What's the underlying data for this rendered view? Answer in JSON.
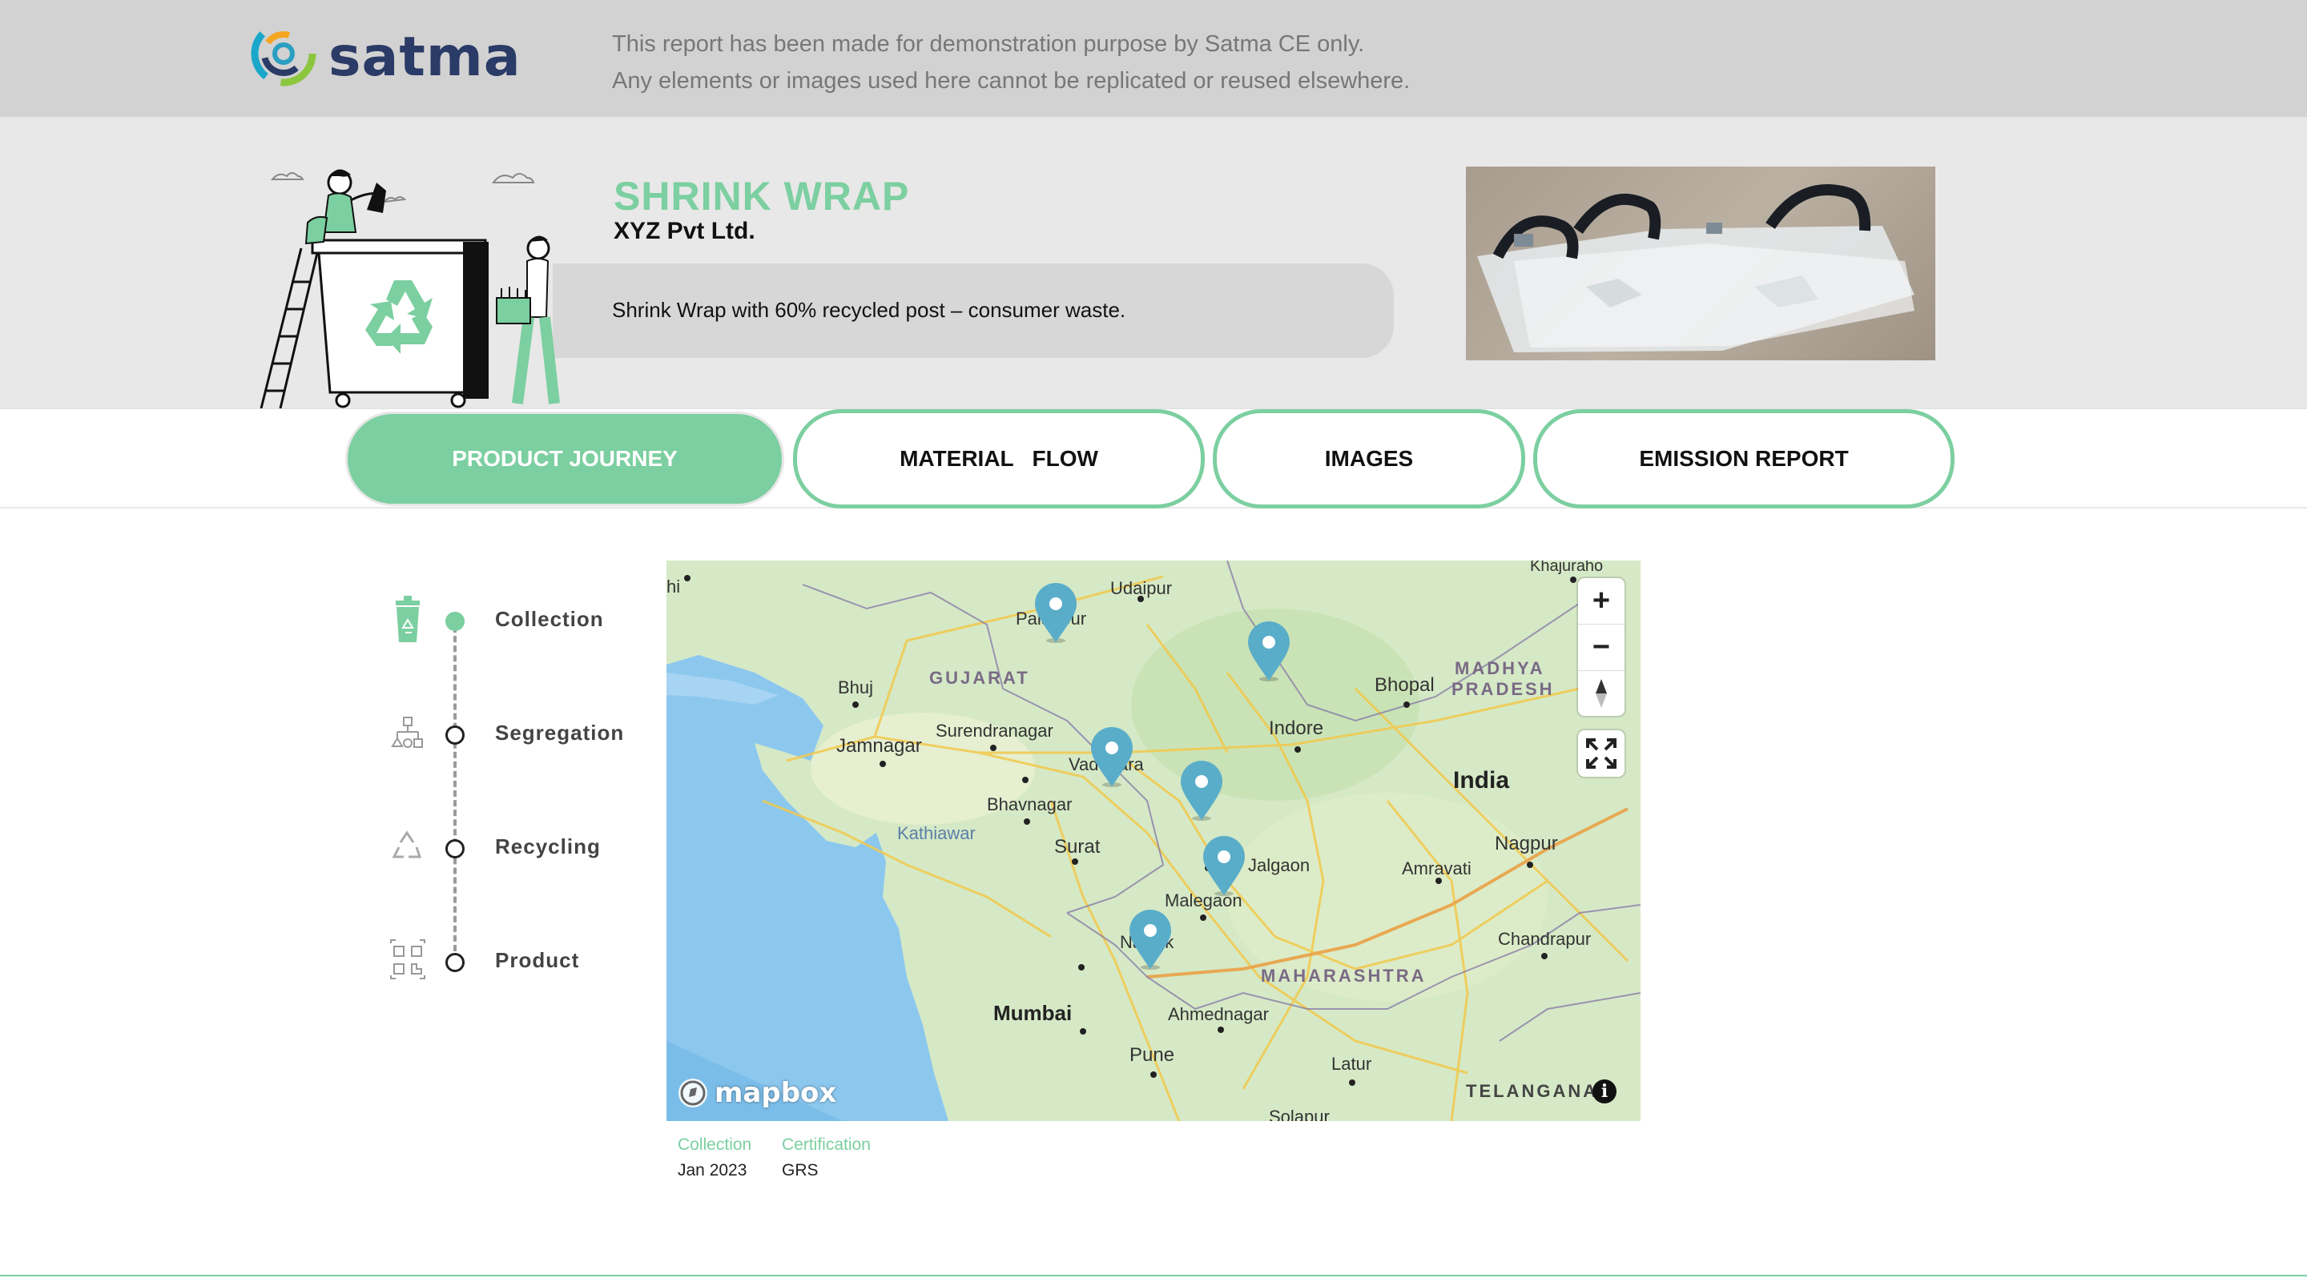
{
  "header": {
    "logo_text": "satma",
    "disclaimer_line1": "This report has been made for demonstration purpose by Satma CE only.",
    "disclaimer_line2": "Any elements or images used here cannot be replicated or reused elsewhere."
  },
  "product": {
    "name": "SHRINK WRAP",
    "company": "XYZ Pvt Ltd.",
    "description": "Shrink Wrap with 60% recycled post – consumer waste."
  },
  "tabs": [
    {
      "label": "PRODUCT JOURNEY",
      "active": true
    },
    {
      "label": "MATERIAL   FLOW",
      "active": false
    },
    {
      "label": "IMAGES",
      "active": false
    },
    {
      "label": "EMISSION REPORT",
      "active": false
    }
  ],
  "journey": {
    "steps": [
      {
        "label": "Collection",
        "icon": "recycle-bin-icon",
        "current": true
      },
      {
        "label": "Segregation",
        "icon": "segregation-icon",
        "current": false
      },
      {
        "label": "Recycling",
        "icon": "recycle-icon",
        "current": false
      },
      {
        "label": "Product",
        "icon": "qr-code-icon",
        "current": false
      }
    ]
  },
  "map": {
    "attribution_logo": "mapbox",
    "zoom_in": "+",
    "zoom_out": "−",
    "labels": {
      "khajuraho": "Khajuraho",
      "udaipur": "Udaipur",
      "palanpur": "Palanpur",
      "bhuj": "Bhuj",
      "gujarat": "GUJARAT",
      "madhya_pradesh_1": "MADHYA",
      "madhya_pradesh_2": "PRADESH",
      "bhopal": "Bhopal",
      "surendranagar": "Surendranagar",
      "jamnagar": "Jamnagar",
      "vadodara": "Vadodara",
      "indore": "Indore",
      "india": "India",
      "bhavnagar": "Bhavnagar",
      "kathiawar": "Kathiawar",
      "surat": "Surat",
      "nagpur": "Nagpur",
      "jalgaon": "Jalgaon",
      "amravati": "Amravati",
      "malegaon": "Malegaon",
      "nashik": "Nashik",
      "chandrapur": "Chandrapur",
      "maharashtra": "MAHARASHTRA",
      "mumbai": "Mumbai",
      "ahmednagar": "Ahmednagar",
      "pune": "Pune",
      "latur": "Latur",
      "telangana": "TELANGANA",
      "solapur": "Solapur",
      "edge_left": "hi"
    },
    "markers": 6
  },
  "details": {
    "collection_label": "Collection",
    "collection_value": "Jan 2023",
    "certification_label": "Certification",
    "certification_value": "GRS"
  },
  "colors": {
    "accent": "#7ccfa0",
    "brand_navy": "#2b3b67",
    "pin": "#5aadc9"
  }
}
